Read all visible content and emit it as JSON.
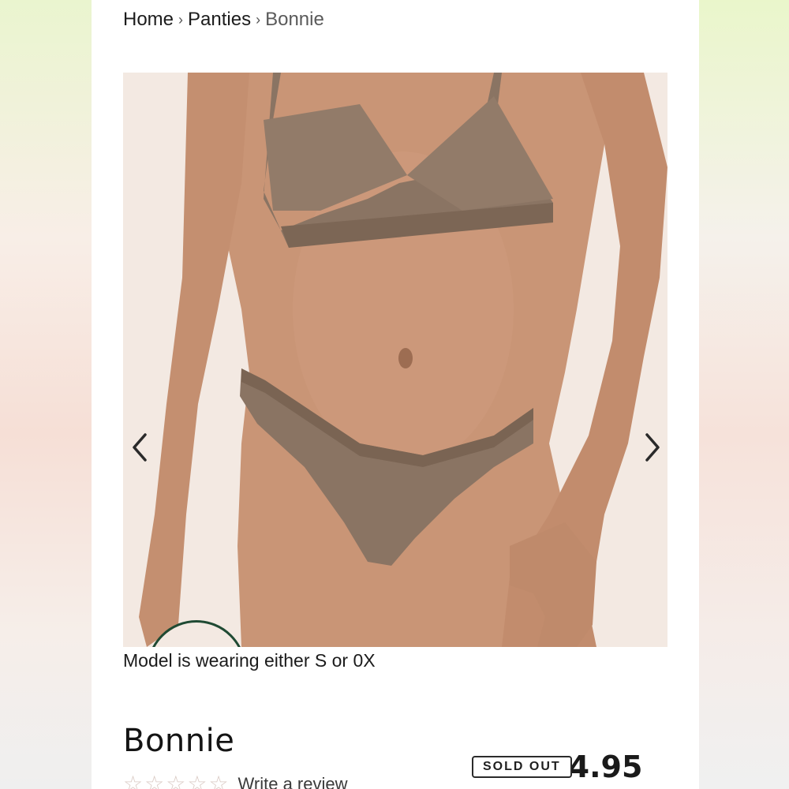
{
  "breadcrumb": {
    "items": [
      "Home",
      "Panties",
      "Bonnie"
    ],
    "separator": "›"
  },
  "product": {
    "name": "Bonnie",
    "image_caption": "Model is wearing either S or 0X",
    "price": "4.95",
    "status_badge": "SOLD OUT",
    "rating_stars_filled": 0,
    "rating_stars_total": 5,
    "review_link": "Write a review"
  },
  "gallery": {
    "prev_icon": "chevron-left-icon",
    "next_icon": "chevron-right-icon"
  },
  "colors": {
    "background_card": "#ffffff",
    "image_backdrop": "#f3e9e2",
    "garment": "#8a7463",
    "skin": "#c99576",
    "badge_accent": "#1f4a33",
    "star_empty": "#d9c9c3"
  }
}
